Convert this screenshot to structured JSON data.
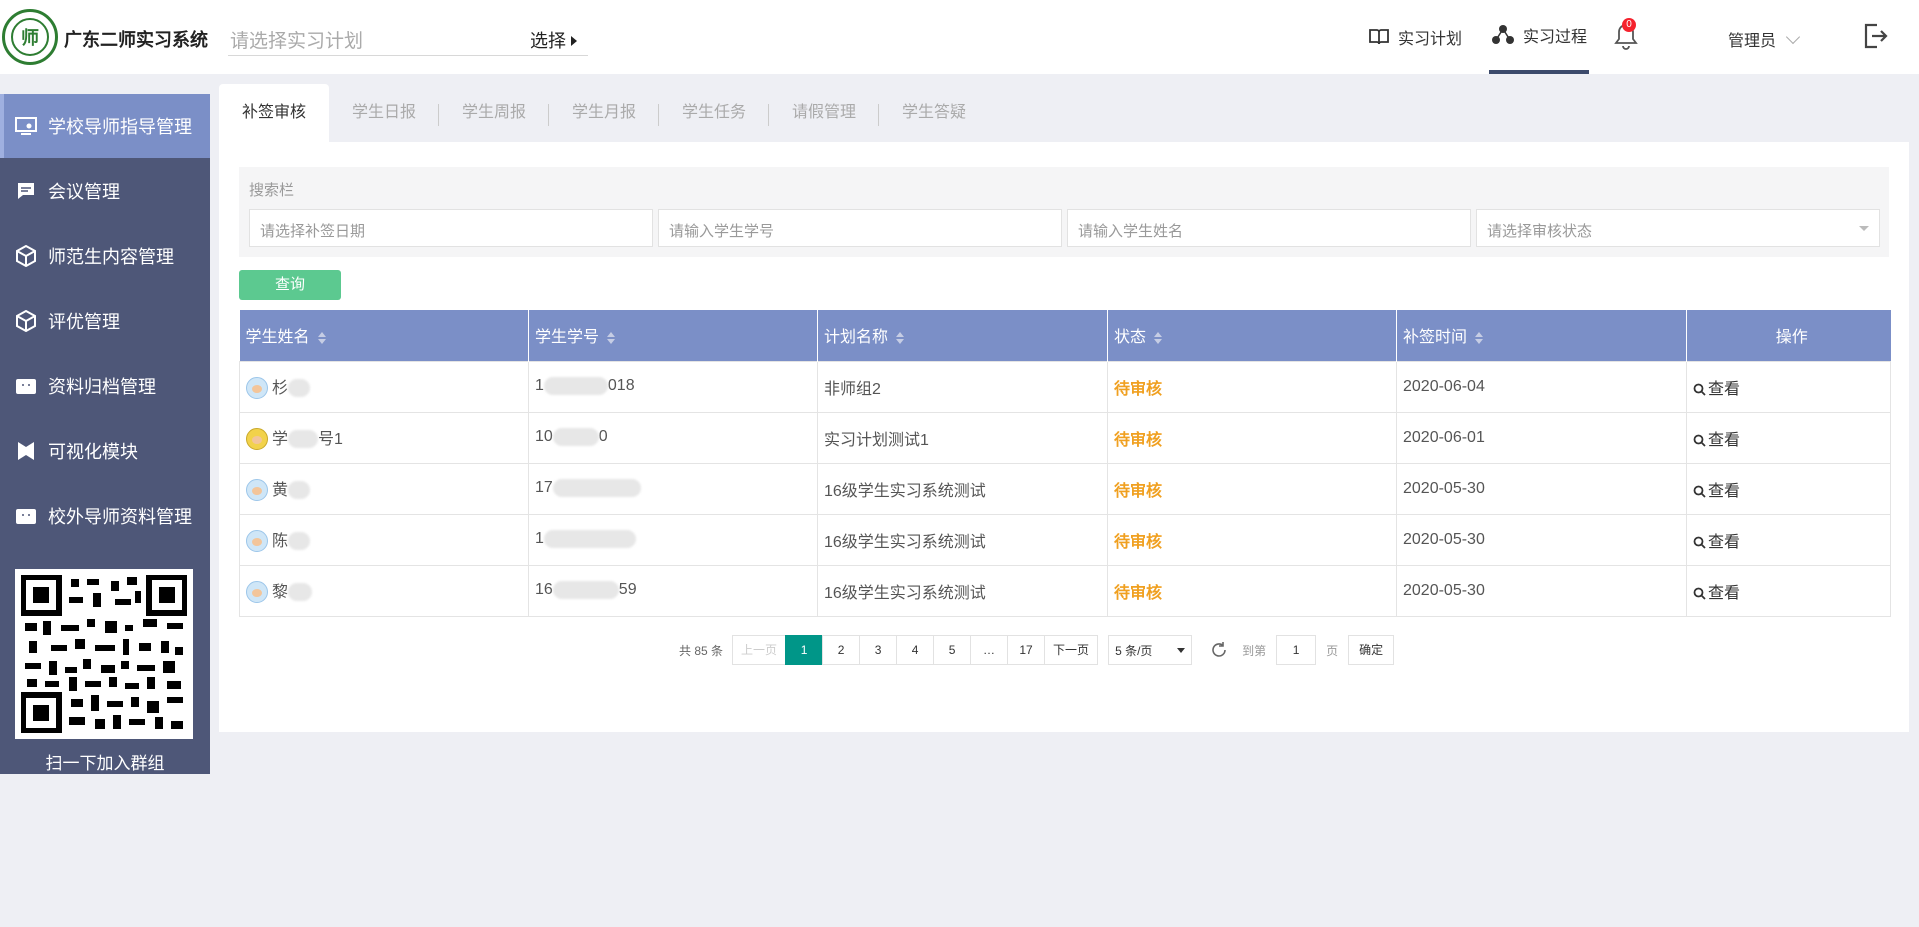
{
  "header": {
    "brand": "广东二师实习系统",
    "plan_placeholder": "请选择实习计划",
    "select_label": "选择",
    "nav": [
      {
        "label": "实习计划",
        "icon": "book-icon"
      },
      {
        "label": "实习过程",
        "icon": "share-nodes-icon"
      }
    ],
    "notifications": "0",
    "user": "管理员"
  },
  "sidebar": {
    "items": [
      {
        "label": "学校导师指导管理",
        "icon": "monitor-icon"
      },
      {
        "label": "会议管理",
        "icon": "chat-icon"
      },
      {
        "label": "师范生内容管理",
        "icon": "cube-icon"
      },
      {
        "label": "评优管理",
        "icon": "cube-icon"
      },
      {
        "label": "资料归档管理",
        "icon": "folder-icon"
      },
      {
        "label": "可视化模块",
        "icon": "chart-icon"
      },
      {
        "label": "校外导师资料管理",
        "icon": "folder-icon"
      }
    ],
    "qr_label": "扫一下加入群组"
  },
  "tabs": [
    "补签审核",
    "学生日报",
    "学生周报",
    "学生月报",
    "学生任务",
    "请假管理",
    "学生答疑"
  ],
  "search": {
    "title": "搜索栏",
    "date_placeholder": "请选择补签日期",
    "id_placeholder": "请输入学生学号",
    "name_placeholder": "请输入学生姓名",
    "status_placeholder": "请选择审核状态",
    "query_label": "查询"
  },
  "table": {
    "columns": [
      "学生姓名",
      "学生学号",
      "计划名称",
      "状态",
      "补签时间",
      "操作"
    ],
    "rows": [
      {
        "name_a": "杉",
        "name_b": "",
        "id_a": "1",
        "id_b": "018",
        "plan": "非师组2",
        "status": "待审核",
        "time": "2020-06-04",
        "action": "查看"
      },
      {
        "name_a": "学",
        "name_b": "号1",
        "id_a": "10",
        "id_b": "0",
        "plan": "实习计划测试1",
        "status": "待审核",
        "time": "2020-06-01",
        "action": "查看"
      },
      {
        "name_a": "黄",
        "name_b": "",
        "id_a": "17",
        "id_b": "",
        "plan": "16级学生实习系统测试",
        "status": "待审核",
        "time": "2020-05-30",
        "action": "查看"
      },
      {
        "name_a": "陈",
        "name_b": "",
        "id_a": "1",
        "id_b": "",
        "plan": "16级学生实习系统测试",
        "status": "待审核",
        "time": "2020-05-30",
        "action": "查看"
      },
      {
        "name_a": "黎",
        "name_b": "",
        "id_a": "16",
        "id_b": "59",
        "plan": "16级学生实习系统测试",
        "status": "待审核",
        "time": "2020-05-30",
        "action": "查看"
      }
    ]
  },
  "pager": {
    "total": "共 85 条",
    "prev": "上一页",
    "pages": [
      "1",
      "2",
      "3",
      "4",
      "5",
      "…",
      "17"
    ],
    "next": "下一页",
    "size": "5 条/页",
    "goto_label": "到第",
    "goto_value": "1",
    "page_unit": "页",
    "confirm": "确定"
  }
}
